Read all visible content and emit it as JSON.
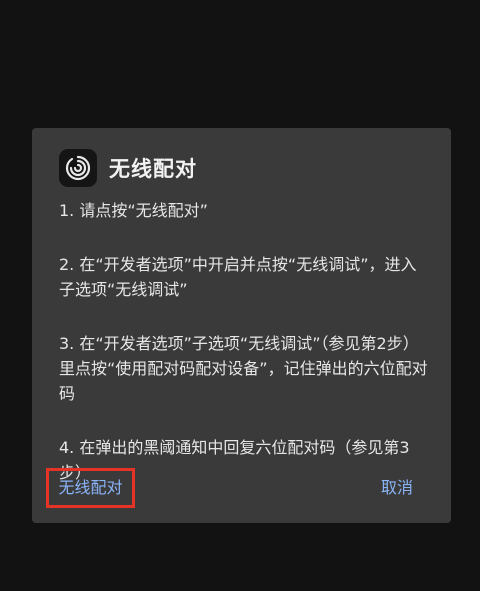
{
  "dialog": {
    "title": "无线配对",
    "icon": "swirl-app-icon",
    "steps": [
      "1. 请点按“无线配对”",
      "2. 在“开发者选项”中开启并点按“无线调试”，进入子选项“无线调试”",
      "3. 在“开发者选项”子选项“无线调试”（参见第2步）里点按“使用配对码配对设备”，记住弹出的六位配对码",
      "4. 在弹出的黑阈通知中回复六位配对码（参见第3步）"
    ],
    "pair_button": "无线配对",
    "cancel_button": "取消"
  },
  "colors": {
    "background": "#121212",
    "dialog": "#3a3a3a",
    "accent": "#8ab4f8",
    "highlight": "#e53425"
  }
}
